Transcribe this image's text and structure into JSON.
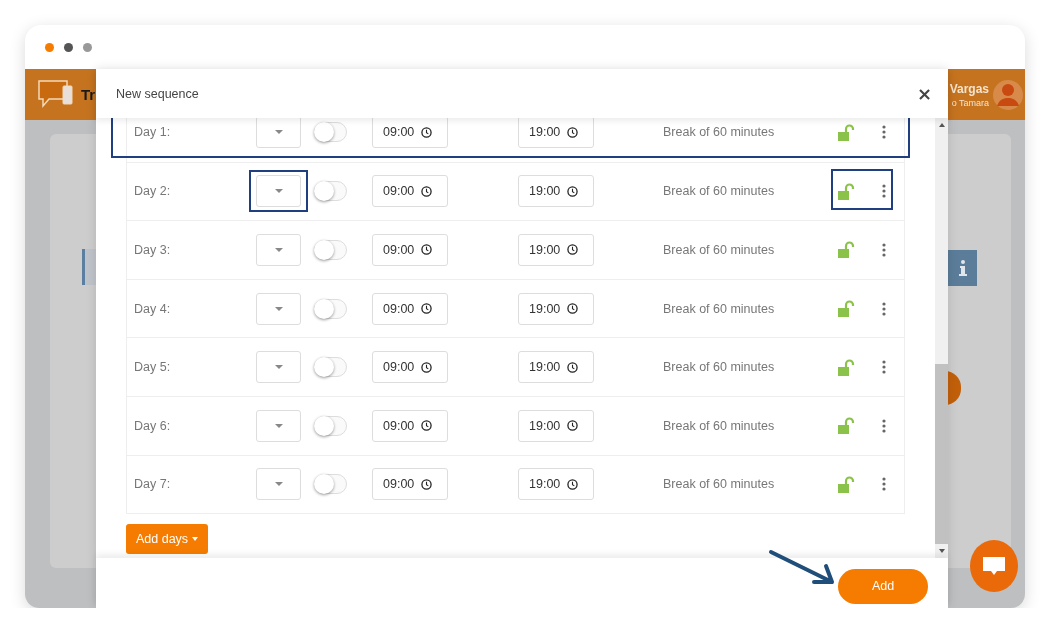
{
  "app_header": {
    "logo_text": "Tr",
    "user_name": "Vargas",
    "user_subtitle": "o Tamara"
  },
  "modal": {
    "title": "New sequence",
    "close": "×",
    "rows": [
      {
        "label": "Day 1:",
        "on": false,
        "start": "09:00",
        "end": "19:00",
        "break_text": "Break of 60 minutes",
        "locked": false,
        "highlighted": true,
        "select_highlighted": false,
        "actions_highlighted": false
      },
      {
        "label": "Day 2:",
        "on": false,
        "start": "09:00",
        "end": "19:00",
        "break_text": "Break of 60 minutes",
        "locked": false,
        "highlighted": false,
        "select_highlighted": true,
        "actions_highlighted": true
      },
      {
        "label": "Day 3:",
        "on": false,
        "start": "09:00",
        "end": "19:00",
        "break_text": "Break of 60 minutes",
        "locked": false,
        "highlighted": false,
        "select_highlighted": false,
        "actions_highlighted": false
      },
      {
        "label": "Day 4:",
        "on": false,
        "start": "09:00",
        "end": "19:00",
        "break_text": "Break of 60 minutes",
        "locked": false,
        "highlighted": false,
        "select_highlighted": false,
        "actions_highlighted": false
      },
      {
        "label": "Day 5:",
        "on": false,
        "start": "09:00",
        "end": "19:00",
        "break_text": "Break of 60 minutes",
        "locked": false,
        "highlighted": false,
        "select_highlighted": false,
        "actions_highlighted": false
      },
      {
        "label": "Day 6:",
        "on": false,
        "start": "09:00",
        "end": "19:00",
        "break_text": "Break of 60 minutes",
        "locked": false,
        "highlighted": false,
        "select_highlighted": false,
        "actions_highlighted": false
      },
      {
        "label": "Day 7:",
        "on": false,
        "start": "09:00",
        "end": "19:00",
        "break_text": "Break of 60 minutes",
        "locked": false,
        "highlighted": false,
        "select_highlighted": false,
        "actions_highlighted": false
      }
    ],
    "add_days_button": "Add days",
    "add_button": "Add",
    "add_pointer": true
  }
}
